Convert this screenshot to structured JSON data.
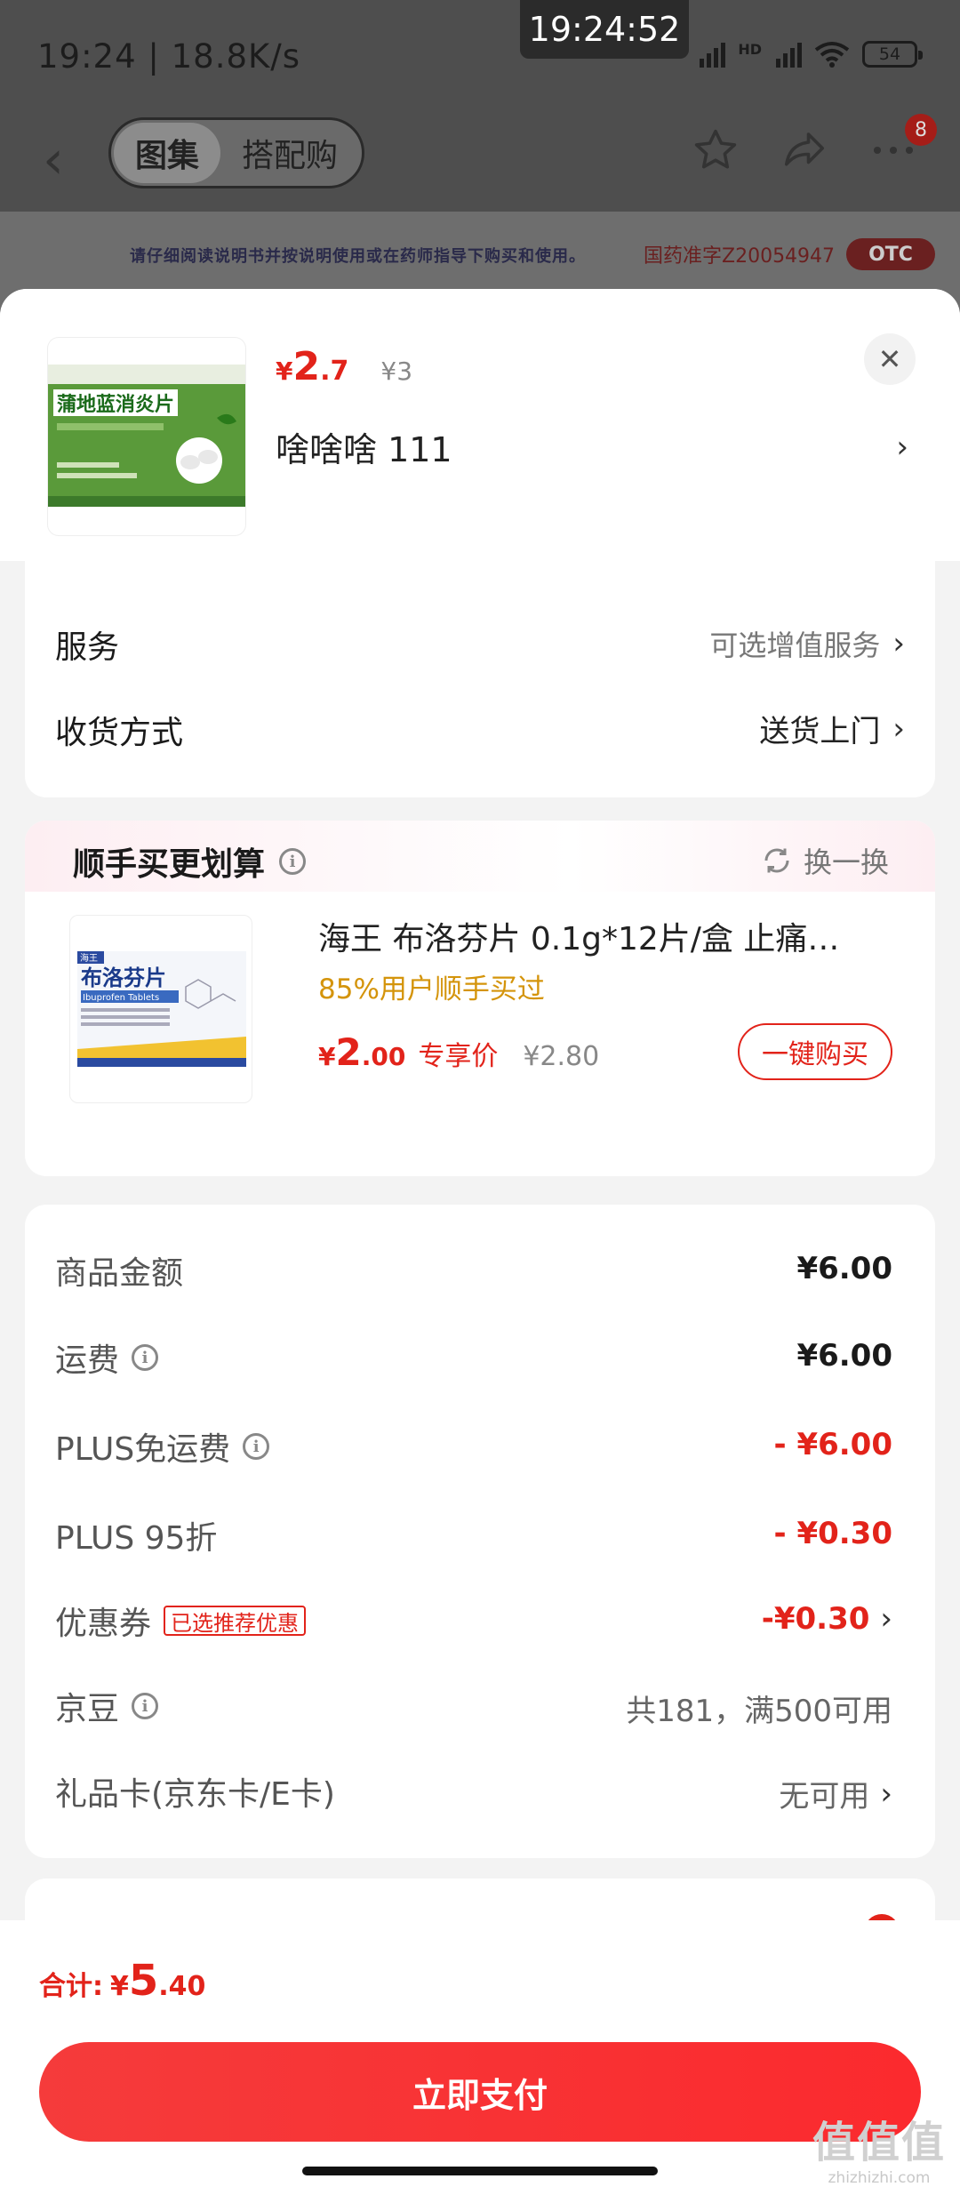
{
  "status_bar": {
    "time": "19:24 | 18.8K/s",
    "clock_overlay": "19:24:52",
    "network_1": "HD",
    "network_2": "HD",
    "battery": "54"
  },
  "nav": {
    "tabs": [
      {
        "label": "图集",
        "active": true
      },
      {
        "label": "搭配购",
        "active": false
      }
    ],
    "badge_count": "8"
  },
  "banner": {
    "notice": "请仔细阅读说明书并按说明使用或在药师指导下购买和使用。",
    "approval": "国药准字Z20054947",
    "otc": "OTC"
  },
  "product": {
    "thumb_title": "蒲地蓝消炎片",
    "price_currency": "¥",
    "price_int": "2",
    "price_dec": ".7",
    "price_original": "¥3",
    "variant": "啥啥啥  111"
  },
  "options": {
    "service_label": "服务",
    "service_value": "可选增值服务",
    "delivery_label": "收货方式",
    "delivery_value": "送货上门"
  },
  "recommend": {
    "title": "顺手买更划算",
    "swap_label": "换一换",
    "name": "海王 布洛芬片 0.1g*12片/盒 止痛…",
    "social": "85%用户顺手买过",
    "price_currency": "¥",
    "price_int": "2",
    "price_dec": ".00",
    "price_tag": "专享价",
    "price_original": "¥2.80",
    "buy_label": "一键购买",
    "thumb_title": "布洛芬片",
    "thumb_subtitle": "Ibuprofen Tablets",
    "thumb_brand": "海王"
  },
  "summary": [
    {
      "label": "商品金额",
      "value": "¥6.00",
      "info": false,
      "style": "normal",
      "chev": false
    },
    {
      "label": "运费",
      "value": "¥6.00",
      "info": true,
      "style": "normal",
      "chev": false
    },
    {
      "label": "PLUS免运费",
      "value": "- ¥6.00",
      "info": true,
      "style": "red",
      "chev": false
    },
    {
      "label": "PLUS 95折",
      "value": "- ¥0.30",
      "info": false,
      "style": "red",
      "chev": false
    },
    {
      "label": "优惠券",
      "tag": "已选推荐优惠",
      "value": "-¥0.30",
      "info": false,
      "style": "red",
      "chev": true
    },
    {
      "label": "京豆",
      "value": "共181，满500可用",
      "info": true,
      "style": "gray",
      "chev": false
    },
    {
      "label": "礼品卡(京东卡/E卡)",
      "value": "无可用",
      "info": false,
      "style": "gray",
      "chev": true
    }
  ],
  "bottom": {
    "total_label": "合计:",
    "total_currency": "¥",
    "total_int": "5",
    "total_dec": ".40",
    "pay_label": "立即支付"
  },
  "watermark": {
    "line1": "值值值",
    "line2": "zhizhizhi.com"
  },
  "colors": {
    "accent_red": "#e2231a",
    "social_gold": "#d4940b"
  }
}
